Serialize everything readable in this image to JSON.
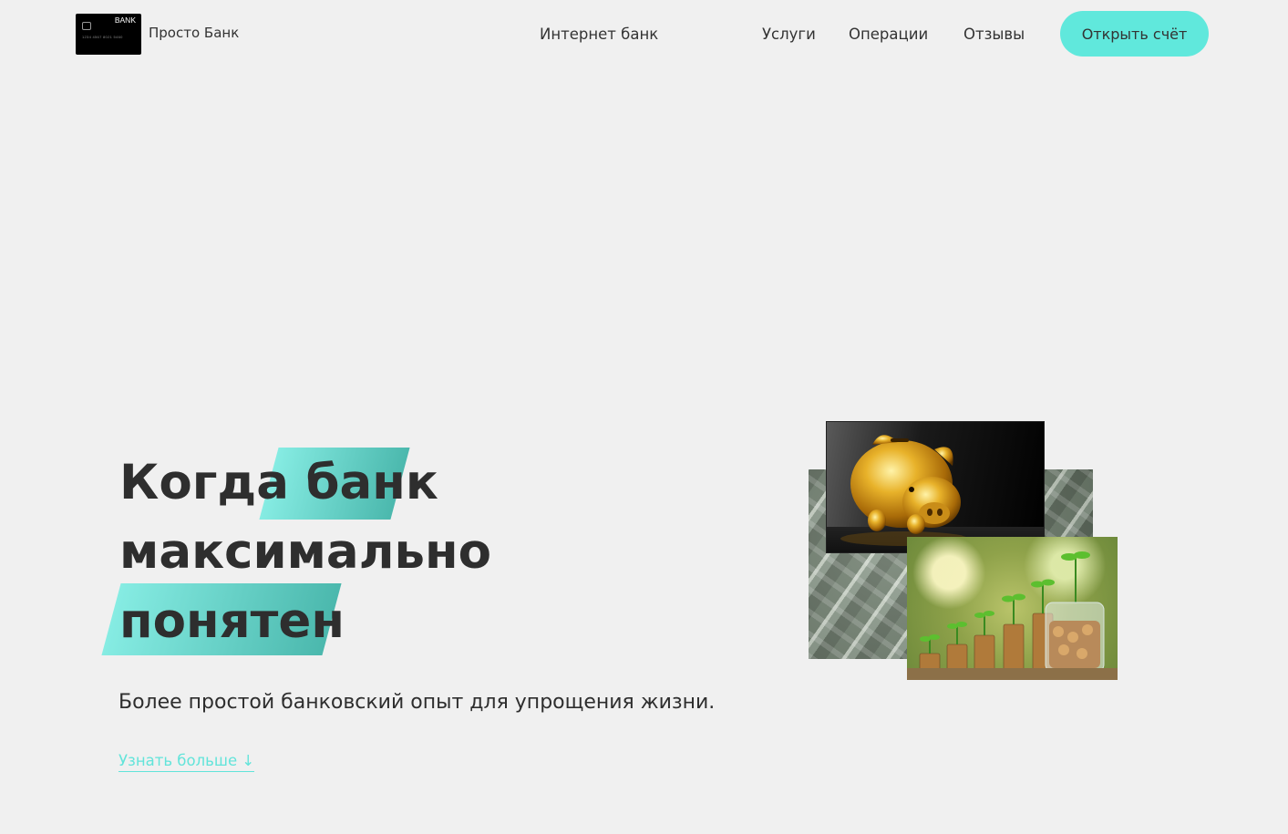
{
  "header": {
    "logo": {
      "card_label": "BANK",
      "card_number": "1234  4567  8021  5460",
      "brand_name": "Просто Банк"
    },
    "nav": {
      "internet_bank": "Интернет банк",
      "services": "Услуги",
      "operations": "Операции",
      "reviews": "Отзывы"
    },
    "cta_label": "Открыть счёт"
  },
  "hero": {
    "headline": {
      "line1_plain": "Когда",
      "line1_highlight": "банк",
      "line2": "максимально",
      "line3_highlight": "понятен"
    },
    "subtitle": "Более простой банковский опыт для упрощения жизни.",
    "more_link": "Узнать больше ↓"
  },
  "collage": {
    "images": [
      {
        "name": "money-stacks",
        "subject": "stacks of dollar bills"
      },
      {
        "name": "golden-piggy-bank",
        "subject": "golden piggy bank on dark background"
      },
      {
        "name": "coins-and-plants",
        "subject": "coin stacks with sprouting plants and jar of coins"
      }
    ]
  },
  "colors": {
    "background": "#f0f0f0",
    "accent": "#60e8dc",
    "accent_dark": "#4bb8ad",
    "text": "#333333"
  }
}
